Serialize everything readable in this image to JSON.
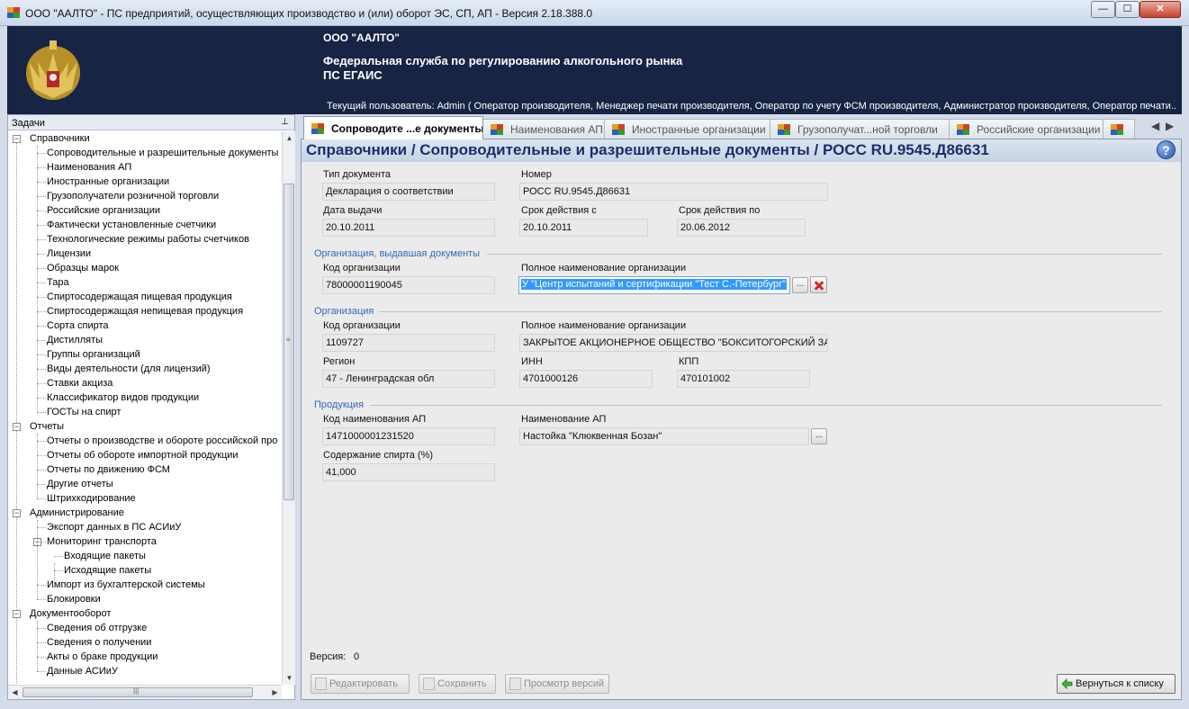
{
  "window": {
    "title": "ООО \"ААЛТО\" - ПС предприятий, осуществляющих производство и (или) оборот ЭС, СП, АП - Версия 2.18.388.0",
    "minimize": "—",
    "maximize": "☐",
    "close": "✕"
  },
  "banner": {
    "org": "ООО \"ААЛТО\"",
    "agency_line1": "Федеральная служба по регулированию алкогольного рынка",
    "agency_line2": "ПС ЕГАИС",
    "current_user": "Текущий пользователь: Admin ( Оператор производителя, Менеджер печати производителя, Оператор по учету ФСМ производителя, Администратор производителя, Оператор печати..."
  },
  "tasks": {
    "header": "Задачи",
    "pin": "ᵖ",
    "groups": [
      {
        "label": "Справочники",
        "items": [
          "Сопроводительные и разрешительные документы",
          "Наименования АП",
          "Иностранные организации",
          "Грузополучатели розничной торговли",
          "Российские организации",
          "Фактически установленные счетчики",
          "Технологические режимы работы счетчиков",
          "Лицензии",
          "Образцы марок",
          "Тара",
          "Спиртосодержащая пищевая продукция",
          "Спиртосодержащая непищевая продукция",
          "Сорта спирта",
          "Дистилляты",
          "Группы организаций",
          "Виды деятельности (для лицензий)",
          "Ставки акциза",
          "Классификатор видов продукции",
          "ГОСТы на спирт"
        ]
      },
      {
        "label": "Отчеты",
        "items": [
          "Отчеты о производстве и обороте российской про",
          "Отчеты об обороте импортной продукции",
          "Отчеты по движению ФСМ",
          "Другие отчеты",
          "Штрихкодирование"
        ]
      },
      {
        "label": "Администрирование",
        "items": [
          "Экспорт данных в ПС АСИиУ",
          "Мониторинг транспорта",
          "Входящие пакеты",
          "Исходящие пакеты",
          "Импорт из бухгалтерской системы",
          "Блокировки"
        ]
      },
      {
        "label": "Документооборот",
        "items": [
          "Сведения об отгрузке",
          "Сведения о получении",
          "Акты о браке продукции",
          "Данные АСИиУ"
        ]
      }
    ]
  },
  "tabs": [
    "Сопроводите ...е документы",
    "Наименования АП",
    "Иностранные организации",
    "Грузополучат...ной торговли",
    "Российские организации"
  ],
  "tab_nav": {
    "prev": "◀",
    "next": "▶"
  },
  "main": {
    "breadcrumb": "Справочники / Сопроводительные и разрешительные документы / РОСС RU.9545.Д86631",
    "help": "?",
    "doc": {
      "type_label": "Тип документа",
      "type_value": "Декларация о соответствии",
      "number_label": "Номер",
      "number_value": "РОСС RU.9545.Д86631",
      "issue_date_label": "Дата выдачи",
      "issue_date_value": "20.10.2011",
      "valid_from_label": "Срок действия с",
      "valid_from_value": "20.10.2011",
      "valid_to_label": "Срок действия по",
      "valid_to_value": "20.06.2012"
    },
    "issuer": {
      "section": "Организация, выдавшая документы",
      "code_label": "Код организации",
      "code_value": "78000001190045",
      "name_label": "Полное наименование организации",
      "name_value": "У \"Центр испытаний и сертификации \"Тест С.-Петербург\"",
      "browse": "..."
    },
    "organization": {
      "section": "Организация",
      "code_label": "Код организации",
      "code_value": "1109727",
      "name_label": "Полное наименование организации",
      "name_value": "ЗАКРЫТОЕ АКЦИОНЕРНОЕ ОБЩЕСТВО \"БОКСИТОГОРСКИЙ ЗАВОД",
      "region_label": "Регион",
      "region_value": "47 - Ленинградская обл",
      "inn_label": "ИНН",
      "inn_value": "4701000126",
      "kpp_label": "КПП",
      "kpp_value": "470101002"
    },
    "product": {
      "section": "Продукция",
      "code_label": "Код наименования АП",
      "code_value": "1471000001231520",
      "name_label": "Наименование АП",
      "name_value": "Настойка \"Клюквенная Бозан\"",
      "browse": "...",
      "alcohol_label": "Содержание спирта (%)",
      "alcohol_value": "41,000"
    },
    "version_label": "Версия:",
    "version_value": "0",
    "buttons": {
      "edit": "Редактировать",
      "save": "Сохранить",
      "versions": "Просмотр версий",
      "back": "Вернуться к списку"
    }
  }
}
